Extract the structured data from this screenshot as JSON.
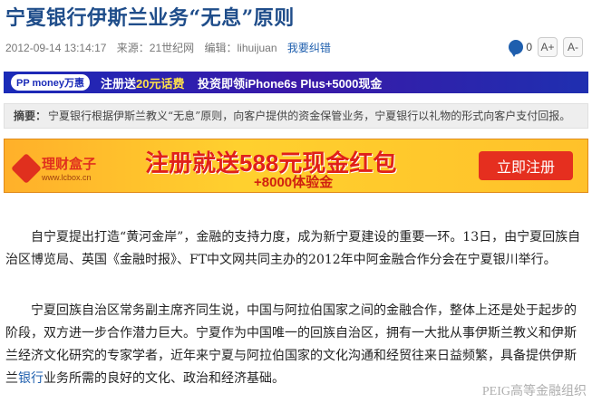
{
  "article": {
    "title": "宁夏银行伊斯兰业务“无息”原则",
    "date": "2012-09-14 13:14:17",
    "source": "来源：21世纪网",
    "editor": "编辑：lihuijuan",
    "report_link": "我要纠错"
  },
  "tools": {
    "comment_count": "0",
    "font_up": "A+",
    "font_down": "A-"
  },
  "banner_top": {
    "brand": "PP money万惠",
    "text_prefix": "注册送",
    "text_highlight": "20元话费",
    "text_rest": "投资即领iPhone6s Plus",
    "text_tail": "+5000现金"
  },
  "summary": {
    "label": "摘要：",
    "text": "宁夏银行根据伊斯兰教义“无息”原则，向客户提供的资金保管业务，宁夏银行以礼物的形式向客户支付回报。"
  },
  "banner_ad": {
    "logo_name": "理财盒子",
    "logo_url": "www.lcbox.cn",
    "headline": "注册就送588元现金红包",
    "subline": "+8000体验金",
    "button": "立即注册"
  },
  "body": {
    "p1": "自宁夏提出打造“黄河金岸”，金融的支持力度，成为新宁夏建设的重要一环。13日，由宁夏回族自治区博览局、英国《金融时报》、FT中文网共同主办的2012年中阿金融合作分会在宁夏银川举行。",
    "p2_a": "宁夏回族自治区常务副主席齐同生说，中国与阿拉伯国家之间的金融合作，整体上还是处于起步的阶段，双方进一步合作潜力巨大。宁夏作为中国唯一的回族自治区，拥有一大批从事伊斯兰教义和伊斯兰经济文化研究的专家学者，近年来宁夏与阿拉伯国家的文化沟通和经贸往来日益频繁，具备提供伊斯兰",
    "p2_link": "银行",
    "p2_b": "业务所需的良好的文化、政治和经济基础。"
  },
  "watermark": "PEIG高等金融组织"
}
